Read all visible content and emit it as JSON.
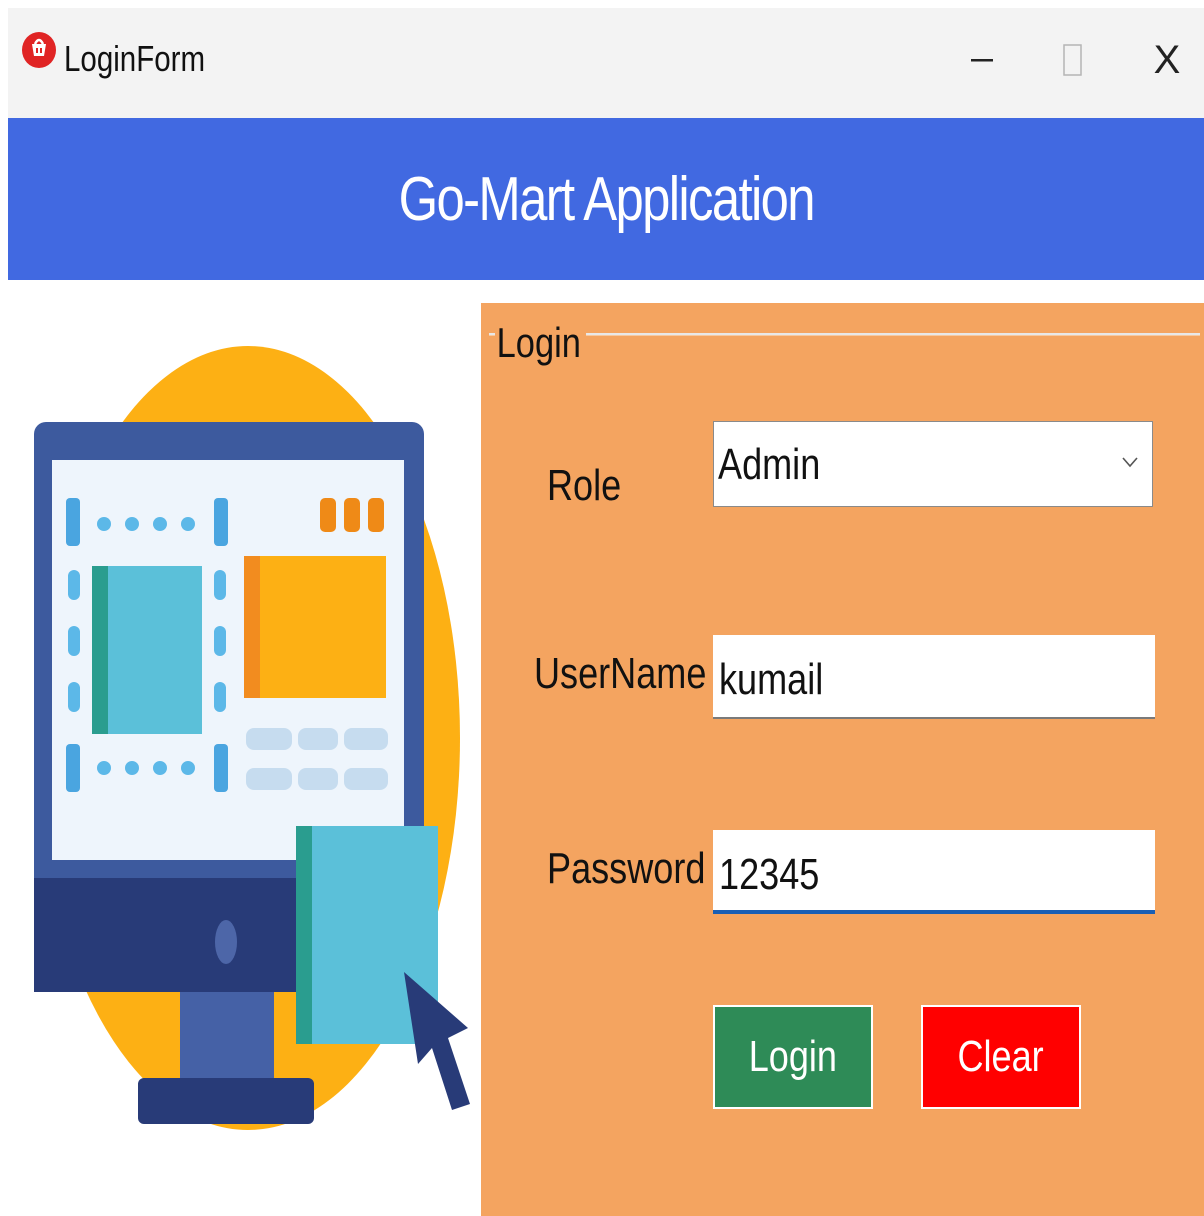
{
  "window": {
    "title": "LoginForm",
    "controls": {
      "minimize": "minimize",
      "maximize": "maximize",
      "close": "X"
    }
  },
  "header": {
    "title": "Go-Mart Application",
    "background": "#4169e1"
  },
  "login_group": {
    "label": "Login",
    "background": "#f4a460",
    "role": {
      "label": "Role",
      "value": "Admin"
    },
    "username": {
      "label": "UserName",
      "value": "kumail"
    },
    "password": {
      "label": "Password",
      "value": "12345"
    },
    "buttons": {
      "login": {
        "label": "Login",
        "color": "#2e8b57"
      },
      "clear": {
        "label": "Clear",
        "color": "#ff0000"
      }
    }
  },
  "icons": [
    "shopping-bag-app-icon",
    "computer-illustration",
    "mouse-cursor-icon",
    "chevron-down-icon"
  ]
}
